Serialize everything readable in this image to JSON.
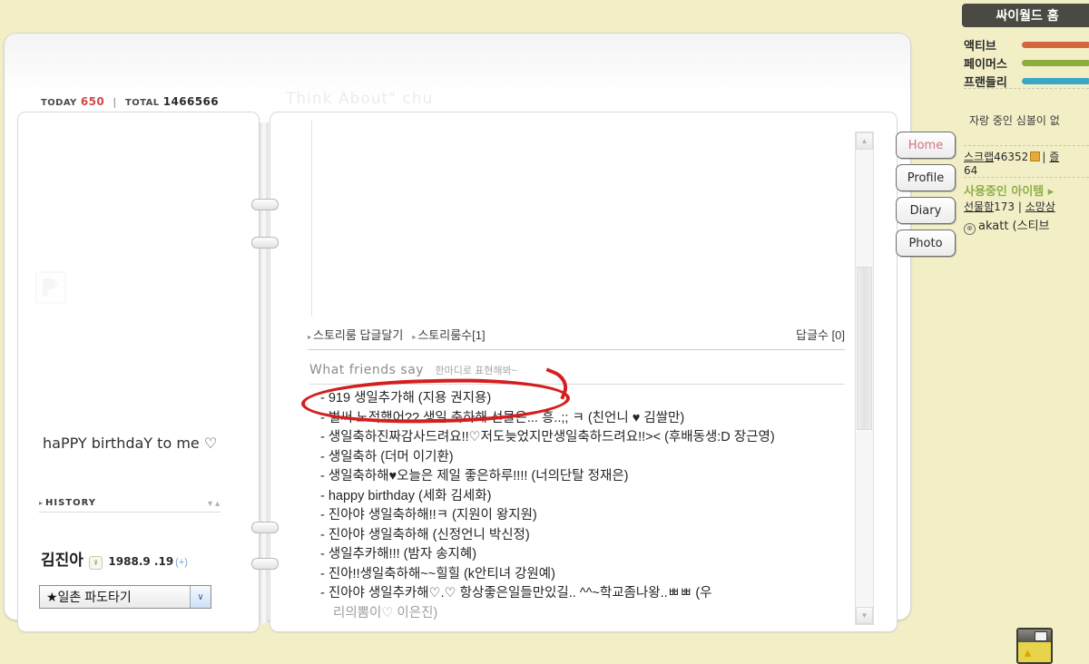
{
  "counter": {
    "today_label": "TODAY",
    "today_value": "650",
    "separator": "|",
    "total_label": "TOTAL",
    "total_value": "1466566"
  },
  "hompy_title": "Think About\" chu",
  "left_page": {
    "broken_image_alt": "broken-image",
    "greeting": "haPPY birthdaY to me ♡",
    "history_label": "HISTORY",
    "history_arrow": "▸",
    "history_updown": "▼▲",
    "owner_name": "김진아",
    "owner_gender": "♀",
    "owner_birthday": "1988.9 .19",
    "owner_plus": "(+)",
    "ilchon_select_value": "★일촌 파도타기",
    "ilchon_select_caret": "∨"
  },
  "right_page": {
    "story_reply_link": "스토리룸 답글달기",
    "story_count_link": "스토리룸수[1]",
    "reply_count": "답글수 [0]",
    "wfs_en": "What friends say",
    "wfs_ko": "한마디로 표현해봐~",
    "comments": [
      "- 919 생일추가해 (지용 권지용)",
      "- 벌써 노적했어?? 생일 축하해 선물은... 흥..;; ㅋ (친언니 ♥ 김쌀만)",
      "- 생일축하진짜감사드려요!!♡저도늦었지만생일축하드려요!!>< (후배동생:D 장근영)",
      "- 생일축하 (더머 이기환)",
      "- 생일축하해♥오늘은 제일 좋은하루!!!! (너의단탈 정재은)",
      "- happy birthday (세화 김세화)",
      "- 진아야 생일축하해!!ㅋ (지원이 왕지원)",
      "- 진아야 생일축하해 (신정언니 박신정)",
      "- 생일추카해!!! (밤자 송지혜)",
      "- 진아!!생일축하해~~힐힐 (k안티녀 강원예)",
      "- 진아야 생일추카해♡.♡ 항상좋은일들만있길.. ^^~학교좀나왕..ㅃㅃ (우",
      "리의뽐이♡ 이은진)"
    ]
  },
  "scrollbar": {
    "up_arrow": "▲",
    "down_arrow": "▼"
  },
  "tabs": [
    {
      "label": "Home",
      "active": true
    },
    {
      "label": "Profile",
      "active": false
    },
    {
      "label": "Diary",
      "active": false
    },
    {
      "label": "Photo",
      "active": false
    }
  ],
  "sidebar": {
    "header": "싸이월드 홈",
    "gauges": [
      {
        "label": "액티브",
        "color": "#d4663c"
      },
      {
        "label": "페이머스",
        "color": "#8cad3e"
      },
      {
        "label": "프랜들리",
        "color": "#3aa8c4"
      }
    ],
    "symbol_text": "자랑 중인 심볼이 없",
    "scrap_label": "스크랩",
    "scrap_value": "46352",
    "scrap_divider": "|",
    "scrap_extra": "즐",
    "scrap_second_line": "64",
    "items_label": "사용중인 아이템 ▸",
    "gift_label": "선물함",
    "gift_value": "173",
    "gift_divider": "|",
    "wish_label": "소망상",
    "user_badge": "⊕",
    "user_text": "akatt (스티브"
  },
  "bottom_widget": {
    "name": "minihompy-widget"
  },
  "colors": {
    "page_background": "#f2efc7",
    "today_red": "#d0474e",
    "tab_active": "#d4737f",
    "annotation_red": "#d41f1f",
    "sidebar_header": "#4a4a42",
    "item_green": "#8faf4a"
  }
}
